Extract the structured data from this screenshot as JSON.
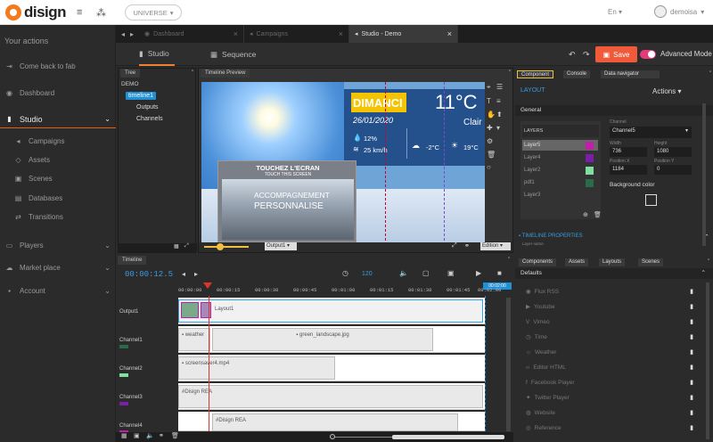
{
  "brand": {
    "name": "disign"
  },
  "topbar": {
    "universe": "UNIVERSE",
    "language": "En",
    "user": "demoisa"
  },
  "sidebar": {
    "title": "Your actions",
    "items": [
      {
        "label": "Come back to fab",
        "icon": "arrow-return-icon"
      },
      {
        "label": "Dashboard",
        "icon": "dashboard-icon"
      },
      {
        "label": "Studio",
        "icon": "studio-icon"
      },
      {
        "label": "Campaigns",
        "icon": "megaphone-icon"
      },
      {
        "label": "Assets",
        "icon": "diamond-icon"
      },
      {
        "label": "Scenes",
        "icon": "scenes-icon"
      },
      {
        "label": "Databases",
        "icon": "database-icon"
      },
      {
        "label": "Transitions",
        "icon": "transitions-icon"
      },
      {
        "label": "Players",
        "icon": "monitor-icon"
      },
      {
        "label": "Market place",
        "icon": "cloud-icon"
      },
      {
        "label": "Account",
        "icon": "account-icon"
      }
    ]
  },
  "tabs": [
    {
      "label": "Dashboard"
    },
    {
      "label": "Campaigns"
    },
    {
      "label": "Studio - Demo"
    }
  ],
  "modes": {
    "studio": "Studio",
    "sequence": "Sequence"
  },
  "actions": {
    "save": "Save",
    "advanced": "Advanced Mode"
  },
  "tree": {
    "tab": "Tree",
    "root": "DEMO",
    "nodes": [
      "timeline1",
      "Outputs",
      "Channels"
    ]
  },
  "preview": {
    "tab": "Timeline Preview",
    "day": "DIMANCI",
    "date": "26/01/2020",
    "temp": "11°C",
    "city": "Clair",
    "humidity": "12%",
    "wind": "25 km/h",
    "temp_low": "-2°C",
    "temp_high": "19°C",
    "touch_title": "TOUCHEZ L'ECRAN",
    "touch_sub": "TOUCH THIS SCREEN",
    "accomp": "ACCOMPAGNEMENT",
    "perso": "PERSONNALISE",
    "output_select": "Output1",
    "edition": "Edition"
  },
  "timeline": {
    "tab": "Timeline",
    "time": "00:00:12.5",
    "fps": "120",
    "end": "00:02:00",
    "ticks": [
      "00:00:00",
      "00:00:15",
      "00:00:30",
      "00:00:45",
      "00:01:00",
      "00:01:15",
      "00:01:30",
      "00:01:45",
      "00:02:00"
    ],
    "tracks": [
      {
        "label": "Output1",
        "clip": "Layout1"
      },
      {
        "label": "Channel1",
        "clip_a": "weather",
        "clip_b": "green_landscape.jpg"
      },
      {
        "label": "Channel2",
        "clip": "screensaver4.mp4"
      },
      {
        "label": "Channel3",
        "clip": "Disign REA"
      },
      {
        "label": "Channel4",
        "clip": "Disign REA"
      }
    ]
  },
  "component": {
    "tabs": [
      "Component",
      "Console",
      "Data navigator"
    ],
    "title": "LAYOUT",
    "actions": "Actions",
    "general": "General",
    "layers_label": "LAYERS",
    "layers": [
      {
        "name": "Layer5",
        "color": "#c21fa8"
      },
      {
        "name": "Layer4",
        "color": "#7a1fa8"
      },
      {
        "name": "Layer2",
        "color": "#80e0a0"
      },
      {
        "name": "pdf1",
        "color": "#2a6b4a"
      },
      {
        "name": "Layer3",
        "color": ""
      }
    ],
    "channel_label": "Channel",
    "channel": "Channel5",
    "width_label": "Width",
    "width": "736",
    "height_label": "Height",
    "height": "1080",
    "posx_label": "Position X",
    "posx": "1184",
    "posy_label": "Position Y",
    "posy": "0",
    "bg_label": "Background color",
    "timeline_props": "TIMELINE PROPERTIES",
    "layer_name": "Layer name"
  },
  "widgets": {
    "tabs": [
      "Components",
      "Assets",
      "Layouts",
      "Scenes"
    ],
    "section": "Defaults",
    "items": [
      "Flux RSS",
      "Youtube",
      "Vimeo",
      "Time",
      "Weather",
      "Editor HTML",
      "Facebook Player",
      "Twitter Player",
      "Website",
      "Reference"
    ]
  },
  "colors": {
    "accent": "#f0593a",
    "brand": "#f47a20",
    "toggle": "#e43b7a",
    "link": "#3a9be0"
  }
}
